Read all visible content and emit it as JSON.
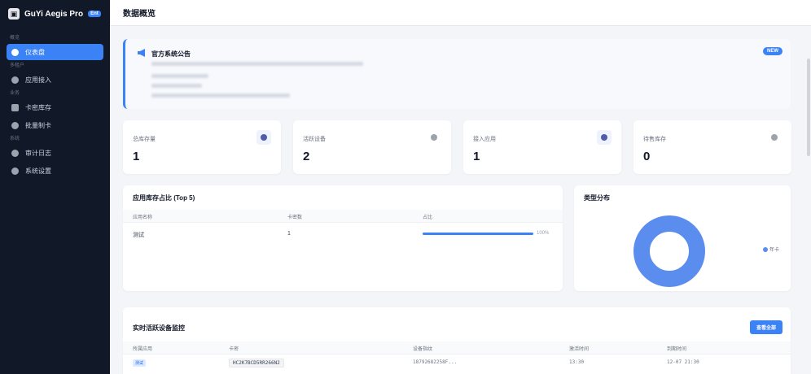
{
  "sidebar": {
    "brand_name": "GuYi Aegis Pro",
    "brand_badge": "Ent",
    "sections": [
      "概览",
      "多租户",
      "业务",
      "系统"
    ],
    "items": [
      {
        "label": "仪表盘",
        "active": true,
        "icon": "dashboard-icon"
      },
      {
        "label": "应用接入",
        "active": false,
        "icon": "apps-icon"
      },
      {
        "label": "卡密库存",
        "active": false,
        "icon": "database-icon"
      },
      {
        "label": "批量制卡",
        "active": false,
        "icon": "add-circle-icon"
      },
      {
        "label": "审计日志",
        "active": false,
        "icon": "history-icon"
      },
      {
        "label": "系统设置",
        "active": false,
        "icon": "gear-icon"
      }
    ]
  },
  "header": {
    "title": "数据概览"
  },
  "notice": {
    "title": "官方系统公告",
    "badge": "NEW",
    "icon": "megaphone-icon"
  },
  "stats": [
    {
      "label": "总库存量",
      "value": "1",
      "icon": "layers-icon"
    },
    {
      "label": "活跃设备",
      "value": "2",
      "icon": "wifi-icon"
    },
    {
      "label": "接入应用",
      "value": "1",
      "icon": "apps-icon"
    },
    {
      "label": "待售库存",
      "value": "0",
      "icon": "tag-icon"
    }
  ],
  "inventory": {
    "title": "应用库存占比 (Top 5)",
    "columns": [
      "应用名称",
      "卡密数",
      "占比"
    ],
    "rows": [
      {
        "name": "测试",
        "count": "1",
        "percent": 100,
        "percent_label": "100%"
      }
    ]
  },
  "type_dist": {
    "title": "类型分布",
    "legend": "年卡",
    "color": "#5b8def"
  },
  "devices": {
    "title": "实时活跃设备监控",
    "view_all": "查看全部",
    "columns": [
      "所属应用",
      "卡密",
      "设备指纹",
      "激活时间",
      "到期时间"
    ],
    "rows": [
      {
        "app": "测试",
        "key": "HC2K7BCD5RR266N2",
        "fingerprint": "18792682258F...",
        "activated": "13:30",
        "expires": "12-07 21:30"
      }
    ]
  },
  "colors": {
    "accent": "#3b82f6",
    "sidebar_bg": "#111827"
  }
}
